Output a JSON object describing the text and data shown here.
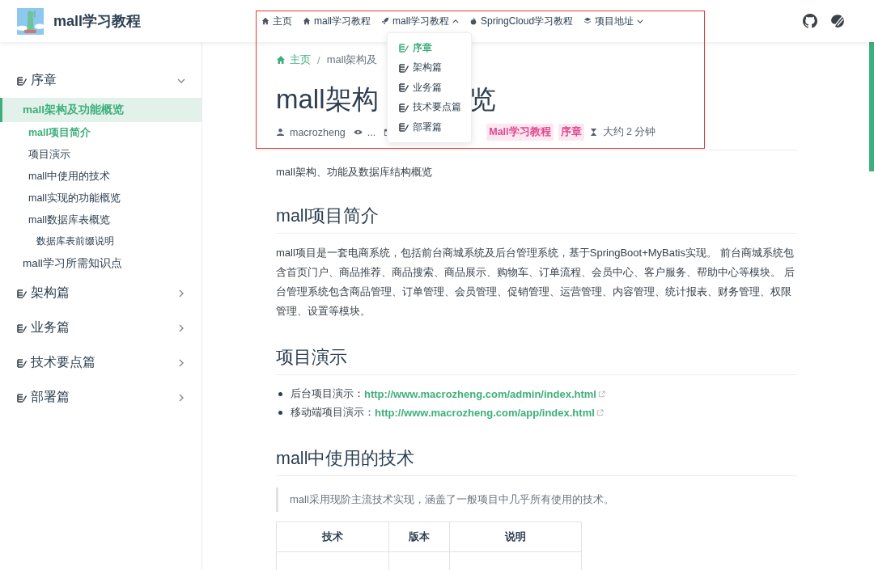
{
  "site_title": "mall学习教程",
  "nav": [
    {
      "label": "主页",
      "kind": "link"
    },
    {
      "label": "mall学习教程",
      "kind": "link"
    },
    {
      "label": "mall学习教程",
      "kind": "menu",
      "expanded": true
    },
    {
      "label": "SpringCloud学习教程",
      "kind": "link"
    },
    {
      "label": "项目地址",
      "kind": "menu",
      "expanded": false
    }
  ],
  "dropdown": [
    {
      "label": "序章",
      "selected": true
    },
    {
      "label": "架构篇",
      "selected": false
    },
    {
      "label": "业务篇",
      "selected": false
    },
    {
      "label": "技术要点篇",
      "selected": false
    },
    {
      "label": "部署篇",
      "selected": false
    }
  ],
  "sidebar": [
    {
      "label": "序章",
      "expanded": true,
      "children": [
        {
          "label": "mall架构及功能概览",
          "selected": true,
          "children": [
            {
              "label": "mall项目简介",
              "selected": true
            },
            {
              "label": "项目演示",
              "selected": false
            },
            {
              "label": "mall中使用的技术",
              "selected": false
            },
            {
              "label": "mall实现的功能概览",
              "selected": false
            },
            {
              "label": "mall数据库表概览",
              "selected": false,
              "children": [
                {
                  "label": "数据库表前缀说明",
                  "selected": false
                }
              ]
            }
          ]
        },
        {
          "label": "mall学习所需知识点",
          "selected": false
        }
      ]
    },
    {
      "label": "架构篇",
      "expanded": false
    },
    {
      "label": "业务篇",
      "expanded": false
    },
    {
      "label": "技术要点篇",
      "expanded": false
    },
    {
      "label": "部署篇",
      "expanded": false
    }
  ],
  "breadcrumb": [
    "主页",
    "mall架构及"
  ],
  "breadcrumb_separator": "/",
  "page_title": {
    "start": "mall架构",
    "end": "览"
  },
  "meta": {
    "author": "macrozheng",
    "views": "...",
    "tags": [
      "Mall学习教程",
      "序章"
    ],
    "reading_time": "大约 2 分钟"
  },
  "summary": "mall架构、功能及数据库结构概览",
  "sections": [
    {
      "heading": "mall项目简介",
      "paragraph": "mall项目是一套电商系统，包括前台商城系统及后台管理系统，基于SpringBoot+MyBatis实现。 前台商城系统包含首页门户、商品推荐、商品搜索、商品展示、购物车、订单流程、会员中心、客户服务、帮助中心等模块。 后台管理系统包含商品管理、订单管理、会员管理、促销管理、运营管理、内容管理、统计报表、财务管理、权限管理、设置等模块。"
    },
    {
      "heading": "项目演示",
      "links": [
        {
          "label": "后台项目演示：",
          "url": "http://www.macrozheng.com/admin/index.html"
        },
        {
          "label": "移动端项目演示：",
          "url": "http://www.macrozheng.com/app/index.html"
        }
      ]
    },
    {
      "heading": "mall中使用的技术",
      "quote": "mall采用现阶主流技术实现，涵盖了一般项目中几乎所有使用的技术。",
      "table": {
        "columns": [
          "技术",
          "版本",
          "说明"
        ]
      }
    }
  ]
}
